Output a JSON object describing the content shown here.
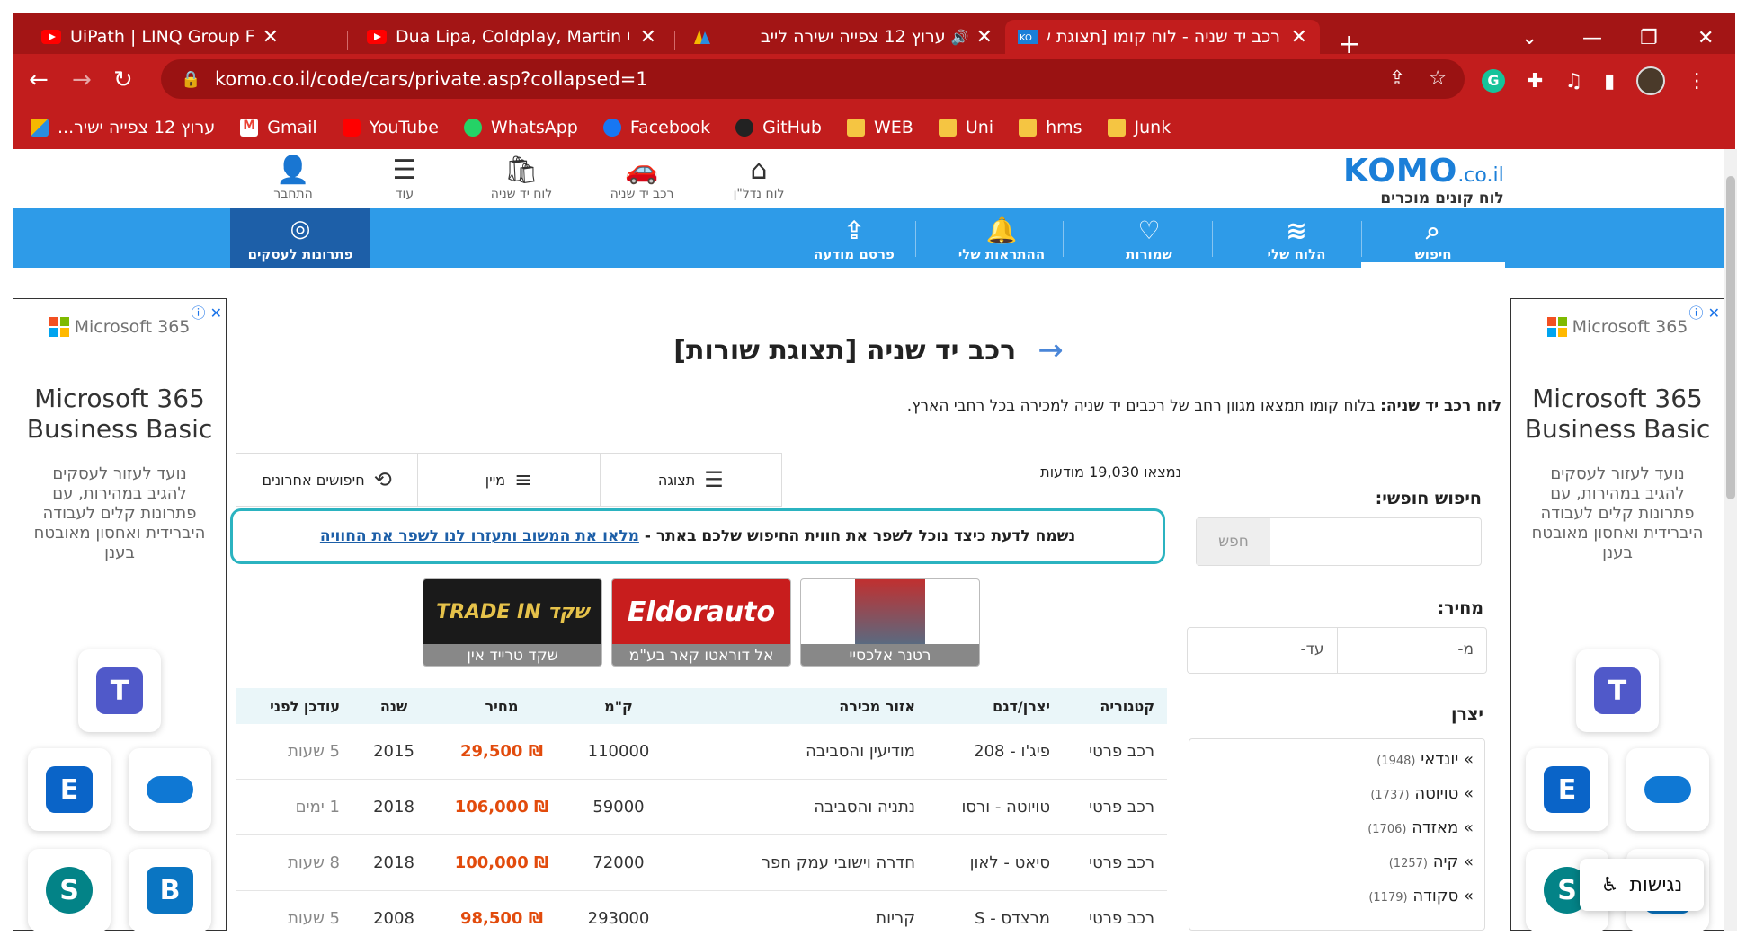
{
  "browser": {
    "tabs": [
      {
        "label": "UiPath | LINQ Group Function | G",
        "icon": "youtube-icon"
      },
      {
        "label": "Dua Lipa, Coldplay, Martin Garrix",
        "icon": "youtube-icon"
      },
      {
        "label": "ערוץ 12 צפייה ישירה לייב",
        "icon": "channel12-icon"
      },
      {
        "label": "רכב יד שניה - לוח קומו [תצוגת שו",
        "icon": "komo-icon"
      }
    ],
    "url": "komo.co.il/code/cars/private.asp?collapsed=1",
    "bookmarks": [
      "ערוץ 12 צפייה ישיר...",
      "Gmail",
      "YouTube",
      "WhatsApp",
      "Facebook",
      "GitHub",
      "WEB",
      "Uni",
      "hms",
      "Junk"
    ],
    "accent": "#c21d1d"
  },
  "site": {
    "logo": "KOMO",
    "logo_suffix": ".co.il",
    "logo_sub": "לוח קונים מוכרים",
    "top_nav": [
      "לוח נדל\"ן",
      "רכב יד שניה",
      "לוח יד שניה",
      "עוד",
      "התחבר"
    ],
    "blue_nav": [
      "חיפוש",
      "הלוח שלי",
      "שמורות",
      "ההתראות שלי",
      "פרסם מודעה"
    ],
    "business": "פתרונות לעסקים"
  },
  "ad": {
    "brand": "Microsoft 365",
    "title_line1": "Microsoft 365",
    "title_line2": "Business Basic",
    "text": "נועד לעזור לעסקים להגיב במהירות, עם פתרונות קלים לעבודה היברידית ואחסון מאובטח בענן"
  },
  "main": {
    "title": "רכב יד שניה [תצוגת שורות]",
    "intro_bold": "לוח רכב יד שניה:",
    "intro_rest": " בלוח קומו תמצאו מגוון רחב של רכבים יד שניה למכירה בכל רחבי הארץ.",
    "found": "נמצאו 19,030 מודעות",
    "tools": [
      "תצוגה",
      "מיין",
      "חיפושים אחרונים"
    ],
    "survey_text": "נשמח לדעת כיצד נוכל לשפר את חווית החיפוש שלכם באתר -",
    "survey_link": "מלאו את המשוב ותעזרו לנו לשפר את החוויה",
    "dealers": [
      {
        "name": "רטנר אלכסיי",
        "img": ""
      },
      {
        "name": "אל דוראטו קאר בע\"מ",
        "img": "Eldorauto"
      },
      {
        "name": "שקד טרייד אין",
        "img": "TRADE IN שקד"
      }
    ]
  },
  "table": {
    "headers": [
      "קטגוריה",
      "יצרן/דגם",
      "אזור מכירה",
      "ק\"מ",
      "מחיר",
      "שנה",
      "עודכן לפני"
    ],
    "rows": [
      [
        "רכב פרטי",
        "פיג'ו - 208",
        "מודיעין והסביבה",
        "110000",
        "₪ 29,500",
        "2015",
        "5 שעות"
      ],
      [
        "רכב פרטי",
        "טויוטה - ורסו",
        "נתניה והסביבה",
        "59000",
        "₪ 106,000",
        "2018",
        "1 ימים"
      ],
      [
        "רכב פרטי",
        "סיאט - לאון",
        "חדרה וישובי עמק חפר",
        "72000",
        "₪ 100,000",
        "2018",
        "8 שעות"
      ],
      [
        "רכב פרטי",
        "מרצדס - S",
        "קריות",
        "293000",
        "₪ 98,500",
        "2008",
        "5 שעות"
      ]
    ]
  },
  "sidebar": {
    "free_search_label": "חיפוש חופשי:",
    "search_button": "חפש",
    "price_label": "מחיר:",
    "price_from": "מ-",
    "price_to": "עד-",
    "maker_label": "יצרן",
    "makers": [
      {
        "name": "יונדאי",
        "count": "(1948)"
      },
      {
        "name": "טויוטה",
        "count": "(1737)"
      },
      {
        "name": "מאזדה",
        "count": "(1706)"
      },
      {
        "name": "קיה",
        "count": "(1257)"
      },
      {
        "name": "סקודה",
        "count": "(1179)"
      }
    ]
  },
  "accessibility": "נגישות"
}
